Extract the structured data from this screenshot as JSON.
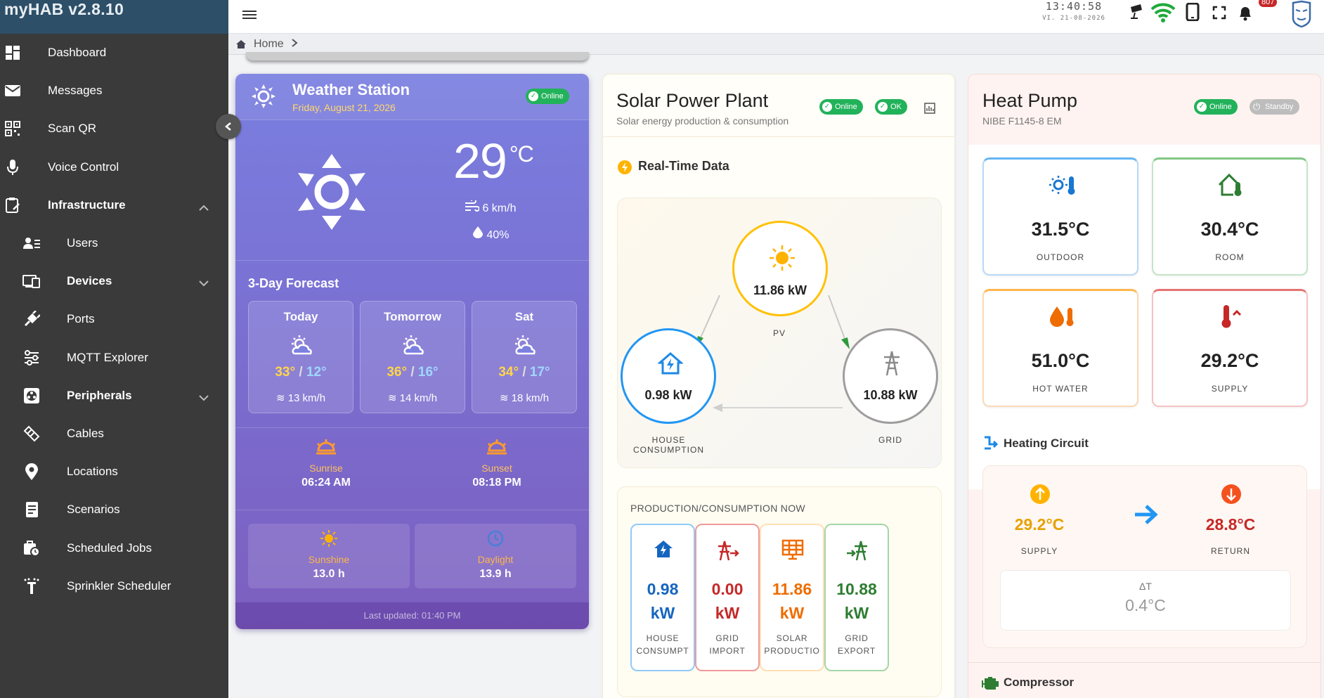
{
  "app": {
    "title": "myHAB v2.8.10"
  },
  "sidebar": {
    "items": [
      {
        "label": "Dashboard",
        "icon": "dashboard-icon"
      },
      {
        "label": "Messages",
        "icon": "mail-icon"
      },
      {
        "label": "Scan QR",
        "icon": "qr-icon"
      },
      {
        "label": "Voice Control",
        "icon": "mic-icon"
      },
      {
        "label": "Infrastructure",
        "icon": "clipboard-icon"
      },
      {
        "label": "Users",
        "icon": "users-icon"
      },
      {
        "label": "Devices",
        "icon": "devices-icon"
      },
      {
        "label": "Ports",
        "icon": "plug-icon"
      },
      {
        "label": "MQTT Explorer",
        "icon": "mqtt-icon"
      },
      {
        "label": "Peripherals",
        "icon": "peripherals-icon"
      },
      {
        "label": "Cables",
        "icon": "cable-icon"
      },
      {
        "label": "Locations",
        "icon": "location-icon"
      },
      {
        "label": "Scenarios",
        "icon": "scenario-icon"
      },
      {
        "label": "Scheduled Jobs",
        "icon": "scheduled-jobs-icon"
      },
      {
        "label": "Sprinkler Scheduler",
        "icon": "sprinkler-icon"
      }
    ]
  },
  "topbar": {
    "time": "13:40:58",
    "date": "VI. 21-08-2026",
    "notifications": "807"
  },
  "breadcrumb": {
    "home": "Home"
  },
  "weather": {
    "title": "Weather Station",
    "date": "Friday, August 21, 2026",
    "status": "Online",
    "temp": "29",
    "unit": "°C",
    "wind": "6 km/h",
    "humidity": "40%",
    "forecast_title": "3-Day Forecast",
    "forecast": [
      {
        "day": "Today",
        "hi": "33°",
        "lo": "12°",
        "wind": "13 km/h"
      },
      {
        "day": "Tomorrow",
        "hi": "36°",
        "lo": "16°",
        "wind": "14 km/h"
      },
      {
        "day": "Sat",
        "hi": "34°",
        "lo": "17°",
        "wind": "18 km/h"
      }
    ],
    "sunrise_label": "Sunrise",
    "sunrise": "06:24 AM",
    "sunset_label": "Sunset",
    "sunset": "08:18 PM",
    "sunshine_label": "Sunshine",
    "sunshine": "13.0 h",
    "daylight_label": "Daylight",
    "daylight": "13.9 h",
    "updated": "Last updated: 01:40 PM"
  },
  "solar": {
    "title": "Solar Power Plant",
    "subtitle": "Solar energy production & consumption",
    "status": "Online",
    "status2": "OK",
    "realtime": "Real-Time Data",
    "pv": "11.86 kW",
    "pv_label": "PV",
    "house": "0.98 kW",
    "house_label": "HOUSE CONSUMPTION",
    "grid": "10.88 kW",
    "grid_label": "GRID",
    "prod_title": "PRODUCTION/CONSUMPTION NOW",
    "boxes": [
      {
        "val1": "0.98",
        "val2": "kW",
        "lab1": "HOUSE",
        "lab2": "CONSUMPT",
        "color": "#1565c0",
        "border": "#90caf9"
      },
      {
        "val1": "0.00",
        "val2": "kW",
        "lab1": "GRID",
        "lab2": "IMPORT",
        "color": "#c62828",
        "border": "#ef9a9a"
      },
      {
        "val1": "11.86",
        "val2": "kW",
        "lab1": "SOLAR",
        "lab2": "PRODUCTIO",
        "color": "#ef6c00",
        "border": "#ffcc80"
      },
      {
        "val1": "10.88",
        "val2": "kW",
        "lab1": "GRID",
        "lab2": "EXPORT",
        "color": "#2e7d32",
        "border": "#a5d6a7"
      }
    ]
  },
  "heatpump": {
    "title": "Heat Pump",
    "subtitle": "NIBE F1145-8 EM",
    "status": "Online",
    "status2": "Standby",
    "temps": [
      {
        "val": "31.5°C",
        "lab": "OUTDOOR"
      },
      {
        "val": "30.4°C",
        "lab": "ROOM"
      },
      {
        "val": "51.0°C",
        "lab": "HOT WATER"
      },
      {
        "val": "29.2°C",
        "lab": "SUPPLY"
      }
    ],
    "circuit_title": "Heating Circuit",
    "supply": "29.2°C",
    "supply_label": "SUPPLY",
    "return": "28.8°C",
    "return_label": "RETURN",
    "delta_label": "ΔT",
    "delta": "0.4°C",
    "compressor": "Compressor"
  }
}
